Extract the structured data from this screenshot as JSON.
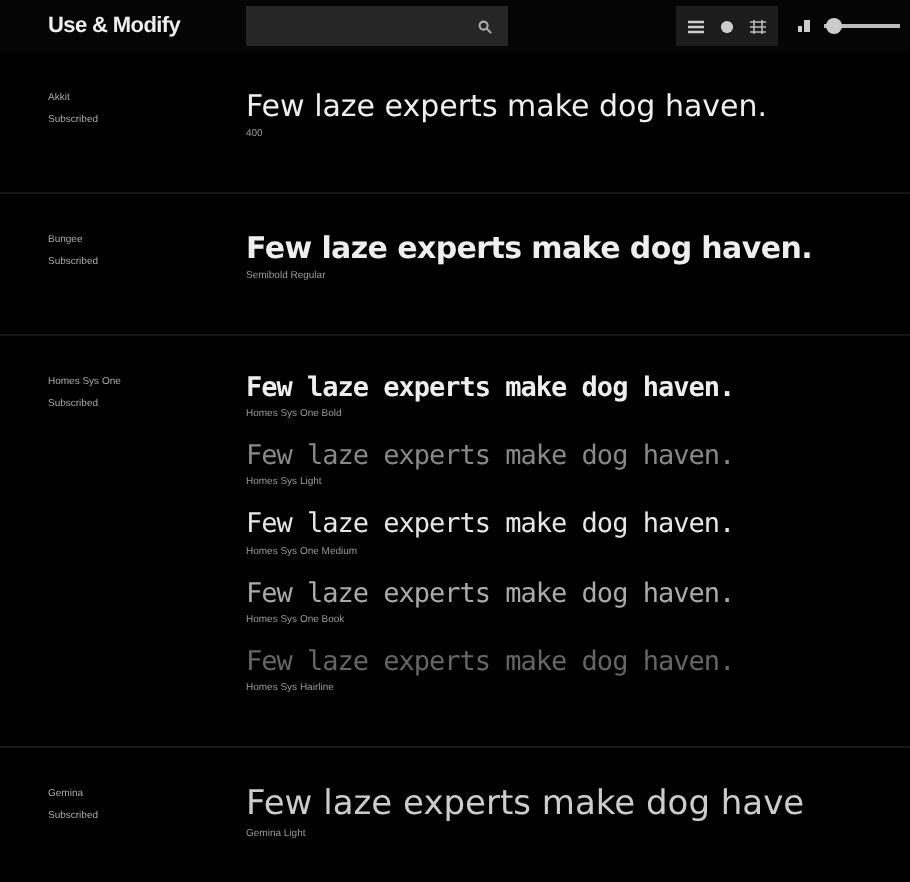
{
  "header": {
    "title": "Use & Modify",
    "size_slider": {
      "level": 0.12
    }
  },
  "families": [
    {
      "name": "Akkit",
      "status": "Subscribed",
      "samples": [
        {
          "kind": "rounded",
          "text": "Few laze experts make dog haven.",
          "style": "400"
        }
      ]
    },
    {
      "name": "Bungee",
      "status": "Subscribed",
      "samples": [
        {
          "kind": "heavy",
          "text": "Few laze experts make dog haven.",
          "style": "Semibold Regular"
        }
      ]
    },
    {
      "name": "Homes Sys One",
      "status": "Subscribed",
      "samples": [
        {
          "kind": "mono-bold",
          "text": "Few laze experts make dog haven.",
          "style": "Homes Sys One Bold"
        },
        {
          "kind": "mono-thin",
          "text": "Few laze experts make dog haven.",
          "style": "Homes Sys Light"
        },
        {
          "kind": "mono-regular",
          "text": "Few laze experts make dog haven.",
          "style": "Homes Sys One Medium"
        },
        {
          "kind": "mono-light",
          "text": "Few laze experts make dog haven.",
          "style": "Homes Sys One Book"
        },
        {
          "kind": "mono-faint",
          "text": "Few laze experts make dog haven.",
          "style": "Homes Sys Hairline"
        }
      ]
    },
    {
      "name": "Gemina",
      "status": "Subscribed",
      "samples": [
        {
          "kind": "light",
          "text": "Few laze experts make dog have",
          "style": "Gemina Light"
        }
      ]
    }
  ]
}
